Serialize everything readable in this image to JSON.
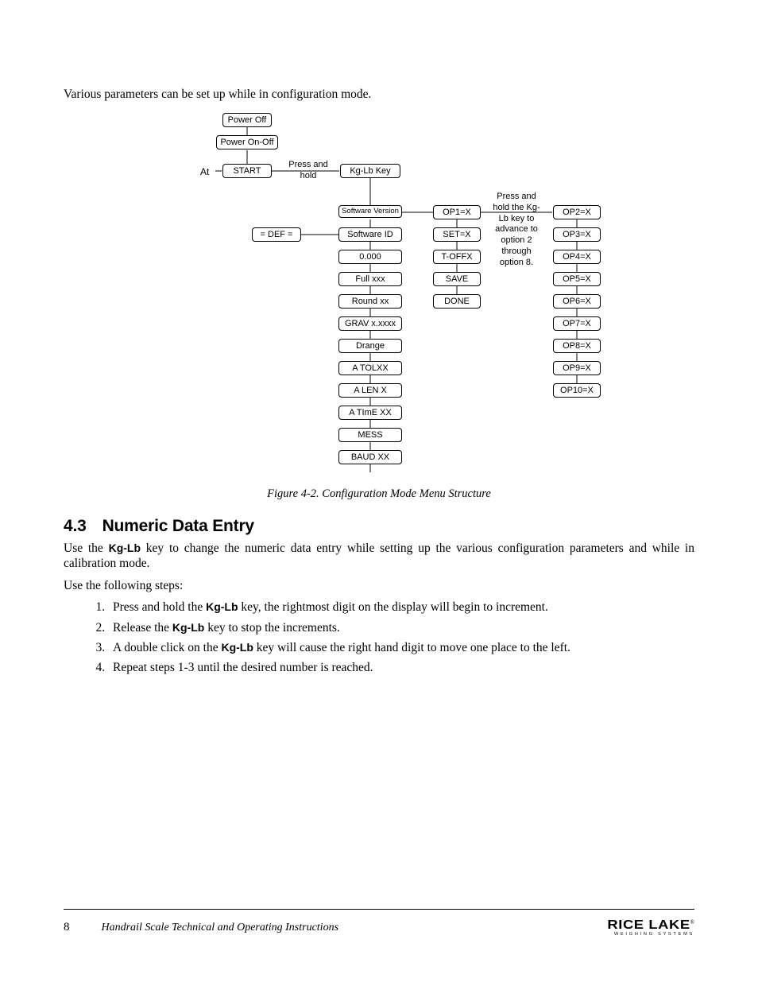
{
  "intro": "Various parameters can be set up while in configuration mode.",
  "diagram": {
    "at": "At",
    "press_hold": "Press and\nhold",
    "advance_note": "Press and\nhold the\nKg-Lb key\nto advance\nto option\n2 through\noption 8.",
    "top": {
      "power_off": "Power Off",
      "power_on": "Power On-Off",
      "start": "START",
      "kglb": "Kg-Lb Key"
    },
    "def": "= DEF =",
    "col_b": [
      "Software Version",
      "Software ID",
      "0.000",
      "Full xxx",
      "Round xx",
      "GRAV  x.xxxx",
      "Drange",
      "A TOLXX",
      "A LEN X",
      "A TImE XX",
      "MESS",
      "BAUD XX"
    ],
    "col_c": [
      "OP1=X",
      "SET=X",
      "T-OFFX",
      "SAVE",
      "DONE"
    ],
    "col_d": [
      "OP2=X",
      "OP3=X",
      "OP4=X",
      "OP5=X",
      "OP6=X",
      "OP7=X",
      "OP8=X",
      "OP9=X",
      "OP10=X"
    ]
  },
  "caption": "Figure 4-2. Configuration Mode Menu Structure",
  "section": {
    "num": "4.3",
    "title": "Numeric Data Entry"
  },
  "p1a": "Use the ",
  "p1_key": "Kg-Lb",
  "p1b": " key to change the numeric data entry while setting up the various configuration parameters and while in calibration mode.",
  "p2": "Use the following steps:",
  "steps": {
    "s1a": "Press and hold the ",
    "s1b": " key, the rightmost digit on the display will begin to increment.",
    "s2a": "Release the ",
    "s2b": " key to stop the increments.",
    "s3a": "A double click on the ",
    "s3b": " key will cause the right hand digit to move one place to the left.",
    "s4": "Repeat steps 1-3 until the desired number is reached."
  },
  "footer": {
    "page": "8",
    "title": "Handrail Scale Technical and Operating Instructions",
    "brand": "RICE LAKE",
    "sub": "WEIGHING SYSTEMS"
  }
}
